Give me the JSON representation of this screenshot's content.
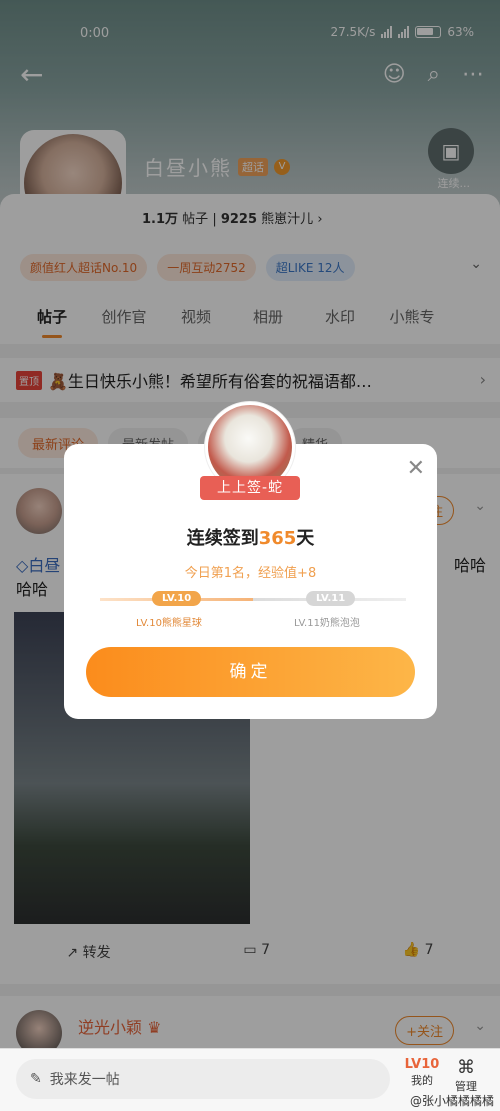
{
  "status": {
    "time": "0:00",
    "speed": "27.5K/s",
    "battery": "63%"
  },
  "profile": {
    "name": "白昼小熊",
    "super_badge": "超话",
    "verified_icon": "V",
    "posts_count": "1.1万",
    "posts_label": "帖子",
    "fans_count": "9225",
    "fans_label": "熊崽汁儿",
    "checkin_label": "连续..."
  },
  "chips": [
    "颜值红人超话No.10",
    "一周互动2752",
    "超LIKE 12人"
  ],
  "tabs": [
    "帖子",
    "创作官",
    "视频",
    "相册",
    "水印",
    "小熊专"
  ],
  "pinned": {
    "badge": "置顶",
    "text": "🧸生日快乐小熊！希望所有俗套的祝福语都…"
  },
  "filters": [
    "最新评论",
    "最新发帖",
    "",
    "精华"
  ],
  "post": {
    "follow": "+关注",
    "text_prefix": "白昼",
    "text_end": "哈哈",
    "text_line2": "哈哈",
    "actions": {
      "repost": "转发",
      "comments": "7",
      "likes": "7"
    }
  },
  "post2": {
    "name": "逆光小颖",
    "follow": "+关注"
  },
  "bottom": {
    "compose": "我来发一帖",
    "mine_level": "LV10",
    "mine": "我的",
    "manage": "管理"
  },
  "watermark": "@张小橘橘橘橘",
  "modal": {
    "ribbon": "上上签-蛇",
    "title_prefix": "连续签到",
    "days": "365",
    "title_suffix": "天",
    "subtitle": "今日第1名，经验值+8",
    "level_current": "LV.10",
    "level_next": "LV.11",
    "level_current_name": "LV.10熊熊星球",
    "level_next_name": "LV.11奶熊泡泡",
    "confirm": "确定"
  },
  "colors": {
    "accent": "#f08a2c",
    "confirm_start": "#fb8c1c",
    "confirm_end": "#fdb648",
    "ribbon": "#e85f55"
  }
}
